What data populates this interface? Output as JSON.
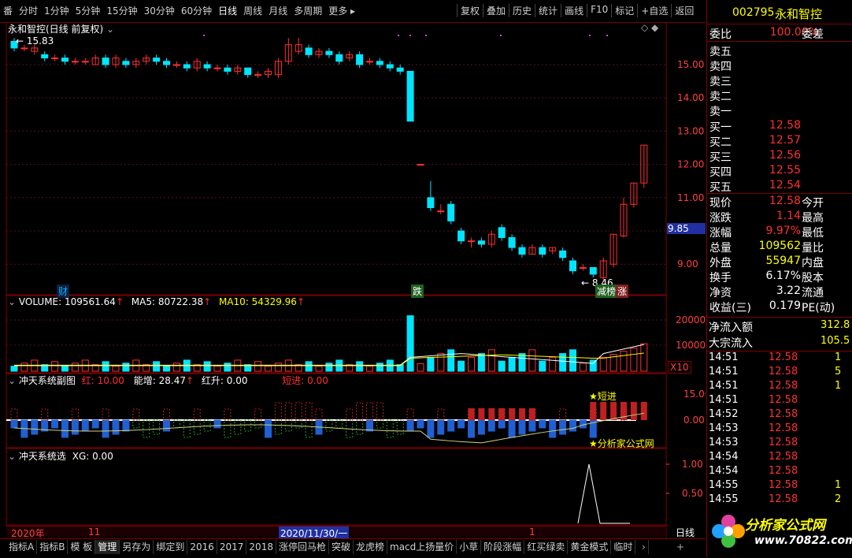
{
  "toolbar": {
    "left_items": [
      "番",
      "分时",
      "1分钟",
      "5分钟",
      "15分钟",
      "30分钟",
      "60分钟",
      "日线",
      "周线",
      "月线",
      "多周期",
      "更多 ▸"
    ],
    "selected": "日线",
    "right_items": [
      "复权",
      "叠加",
      "历史",
      "统计",
      "画线",
      "F10",
      "标记",
      "+自选",
      "返回"
    ]
  },
  "main_chart": {
    "title": "永和智控(日线 前复权)",
    "high_label": "15.83",
    "low_label": "8.46",
    "marker_cai": "财",
    "marker_die": "跌",
    "marker_lhb": "减榜",
    "marker_zhang": "涨",
    "price_tag": "9.85",
    "y_ticks": [
      "15.00",
      "14.00",
      "13.00",
      "12.00",
      "11.00",
      "10.00",
      "9.00"
    ]
  },
  "volume_panel": {
    "label": "VOLUME: 109561.64",
    "ma5": "MA5: 80722.38",
    "ma10": "MA10: 54329.96",
    "y_ticks": [
      "20000",
      "10000"
    ],
    "unit": "X10"
  },
  "indicator1": {
    "name": "冲天系统副图",
    "red": "红: 10.00",
    "energy": "能增: 28.47",
    "redrise": "红升: 0.00",
    "short": "短进: 0.00",
    "tag_short": "★短进",
    "tag_site": "★分析家公式网",
    "y_ticks": [
      "15.00",
      "0.00"
    ]
  },
  "indicator2": {
    "name": "冲天系统选",
    "xg": "XG: 0.00",
    "y_ticks": [
      "1.00",
      "0.50"
    ]
  },
  "timeline": {
    "year": "2020年",
    "month11": "11",
    "cursor_date": "2020/11/30/一",
    "month1": "1",
    "period": "日线"
  },
  "bottom_tabs": [
    "指标A",
    "指标B",
    "模 板",
    "管理",
    "另存为",
    "绑定到",
    "2016",
    "2017",
    "2018",
    "涨停回马枪",
    "突破",
    "龙虎榜",
    "macd上扬量价",
    "小草",
    "阶段涨幅",
    "红买绿卖",
    "黄金模式",
    "临时"
  ],
  "bottom_selected": "管理",
  "side": {
    "code": "002795",
    "name": "永和智控",
    "weibi_label": "委比",
    "weibi_value": "100.00%",
    "weicha_label": "委差",
    "sells": [
      {
        "label": "卖五",
        "price": ""
      },
      {
        "label": "卖四",
        "price": ""
      },
      {
        "label": "卖三",
        "price": ""
      },
      {
        "label": "卖二",
        "price": ""
      },
      {
        "label": "卖一",
        "price": ""
      }
    ],
    "buys": [
      {
        "label": "买一",
        "price": "12.58"
      },
      {
        "label": "买二",
        "price": "12.57"
      },
      {
        "label": "买三",
        "price": "12.56"
      },
      {
        "label": "买四",
        "price": "12.55"
      },
      {
        "label": "买五",
        "price": "12.54"
      }
    ],
    "stats": [
      {
        "k": "现价",
        "v": "12.58",
        "k2": "今开"
      },
      {
        "k": "涨跌",
        "v": "1.14",
        "k2": "最高"
      },
      {
        "k": "涨幅",
        "v": "9.97%",
        "k2": "最低"
      },
      {
        "k": "总量",
        "v": "109562",
        "k2": "量比"
      },
      {
        "k": "外盘",
        "v": "55947",
        "k2": "内盘"
      },
      {
        "k": "换手",
        "v": "6.17%",
        "k2": "股本"
      },
      {
        "k": "净资",
        "v": "3.22",
        "k2": "流通"
      },
      {
        "k": "收益(三)",
        "v": "0.179",
        "k2": "PE(动)"
      }
    ],
    "netflow_label": "净流入额",
    "netflow_value": "312.8",
    "block_label": "大宗流入",
    "block_value": "105.5",
    "ticks": [
      {
        "t": "14:51",
        "p": "12.58",
        "q": "1"
      },
      {
        "t": "14:51",
        "p": "12.58",
        "q": "5"
      },
      {
        "t": "14:51",
        "p": "12.58",
        "q": "1"
      },
      {
        "t": "14:51",
        "p": "12.58",
        "q": ""
      },
      {
        "t": "14:52",
        "p": "12.58",
        "q": ""
      },
      {
        "t": "14:53",
        "p": "12.58",
        "q": ""
      },
      {
        "t": "14:53",
        "p": "12.58",
        "q": ""
      },
      {
        "t": "14:54",
        "p": "12.58",
        "q": ""
      },
      {
        "t": "14:54",
        "p": "12.58",
        "q": ""
      },
      {
        "t": "14:55",
        "p": "12.58",
        "q": "1"
      },
      {
        "t": "14:55",
        "p": "12.58",
        "q": "2"
      }
    ],
    "watermark": "分析家公式网",
    "watermark_url": "www.70822.com"
  },
  "colors": {
    "up": "#ff3030",
    "down": "#00e5ff",
    "frame": "#800000"
  }
}
